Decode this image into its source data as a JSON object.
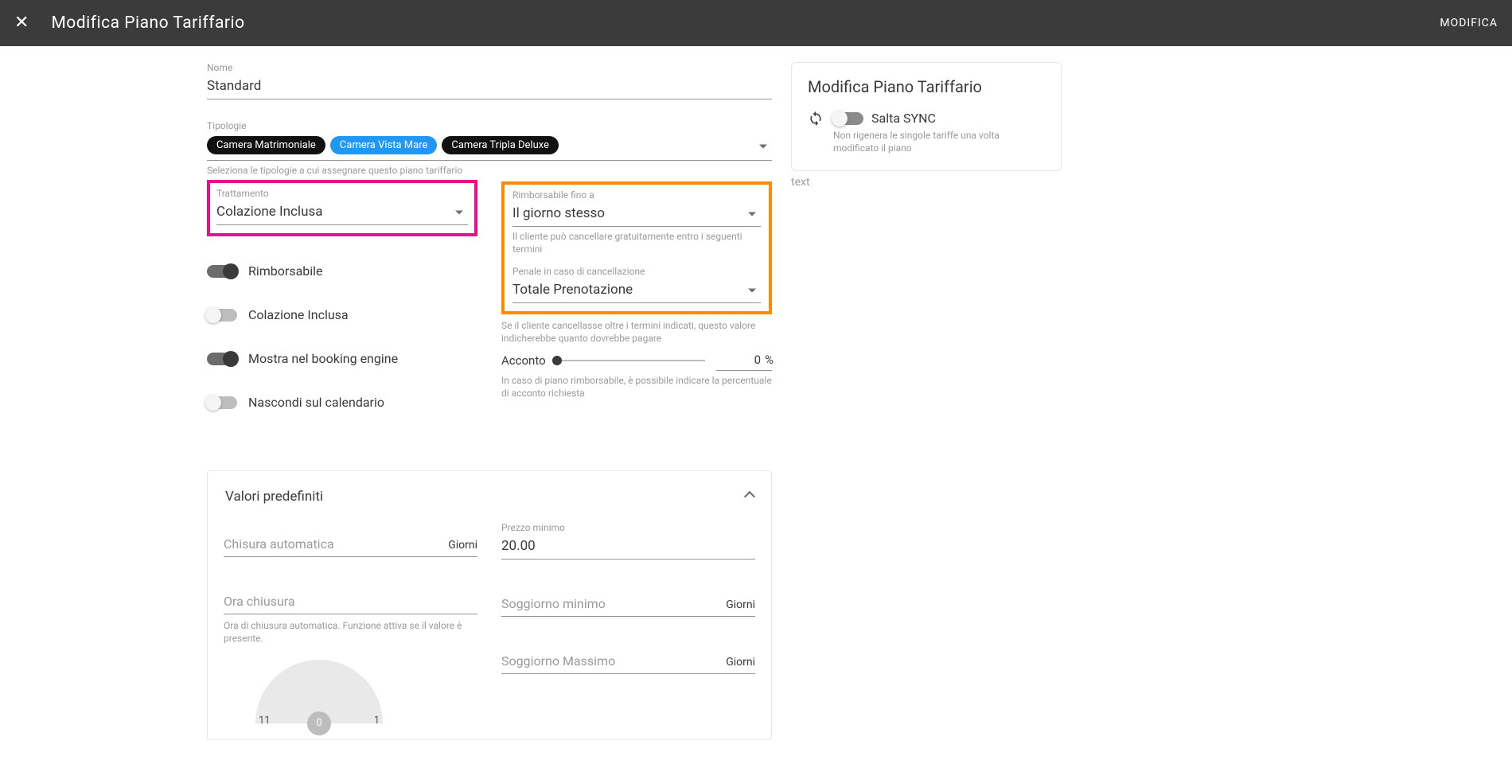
{
  "header": {
    "title": "Modifica Piano Tariffario",
    "action": "MODIFICA"
  },
  "form": {
    "name_label": "Nome",
    "name_value": "Standard",
    "types_label": "Tipologie",
    "types_help": "Seleziona le tipologie a cui assegnare questo piano tariffario",
    "chips": [
      {
        "label": "Camera Matrimoniale",
        "variant": "dark"
      },
      {
        "label": "Camera Vista Mare",
        "variant": "blue"
      },
      {
        "label": "Camera Tripla Deluxe",
        "variant": "dark"
      }
    ],
    "treatment_label": "Trattamento",
    "treatment_value": "Colazione Inclusa",
    "switches": {
      "refundable": {
        "label": "Rimborsabile",
        "on": true
      },
      "breakfast": {
        "label": "Colazione Inclusa",
        "on": false
      },
      "show_be": {
        "label": "Mostra nel booking engine",
        "on": true
      },
      "hide_cal": {
        "label": "Nascondi sul calendario",
        "on": false
      }
    },
    "refund_until_label": "Rimborsabile fino a",
    "refund_until_value": "Il giorno stesso",
    "refund_until_help": "Il cliente può cancellare gratuitamente entro i seguenti termini",
    "penalty_label": "Penale in caso di cancellazione",
    "penalty_value": "Totale Prenotazione",
    "penalty_help": "Se il cliente cancellasse oltre i termini indicati, questo valore indicherebbe quanto dovrebbe pagare",
    "deposit_label": "Acconto",
    "deposit_value": "0",
    "deposit_unit": "%",
    "deposit_help": "In caso di piano rimborsabile, è possibile indicare la percentuale di acconto richiesta"
  },
  "panel": {
    "title": "Valori predefiniti",
    "left": {
      "auto_close_label": "Chisura automatica",
      "auto_close_suffix": "Giorni",
      "close_time_label": "Ora chiusura",
      "close_time_help": "Ora di chiusura automatica. Funzione attiva se il valore è presente.",
      "clock_left": "11",
      "clock_center": "0",
      "clock_right": "1"
    },
    "right": {
      "min_price_label": "Prezzo minimo",
      "min_price_value": "20.00",
      "min_stay_label": "Soggiorno minimo",
      "min_stay_suffix": "Giorni",
      "max_stay_label": "Soggiorno Massimo",
      "max_stay_suffix": "Giorni"
    }
  },
  "side": {
    "title": "Modifica Piano Tariffario",
    "skip_sync_label": "Salta SYNC",
    "skip_sync_desc": "Non rigenera le singole tariffe una volta modificato il piano",
    "stray_text": "text"
  }
}
